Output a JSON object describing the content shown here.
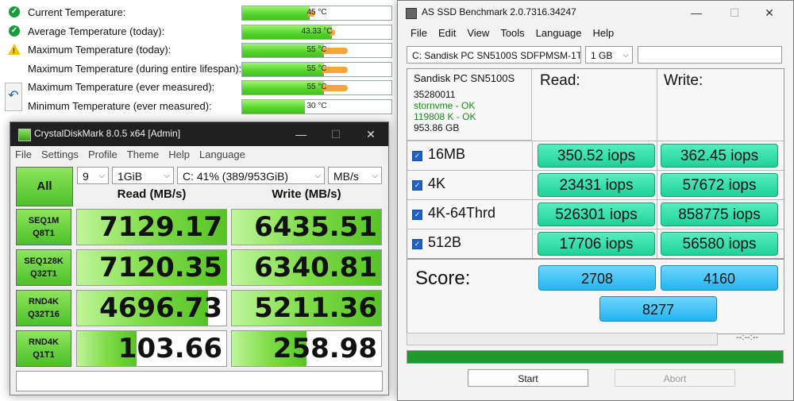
{
  "temps": [
    {
      "label": "Current Temperature:",
      "value": "45 °C",
      "status": "ok",
      "fill": 0.45,
      "orange": 0.05
    },
    {
      "label": "Average Temperature (today):",
      "value": "43.33 °C",
      "status": "ok",
      "fill": 0.6,
      "orange": 0.03
    },
    {
      "label": "Maximum Temperature (today):",
      "value": "55 °C",
      "status": "warn",
      "fill": 0.55,
      "orange": 0.17
    },
    {
      "label": "Maximum Temperature (during entire lifespan):",
      "value": "55 °C",
      "status": "none",
      "fill": 0.55,
      "orange": 0.17
    },
    {
      "label": "Maximum Temperature (ever measured):",
      "value": "55 °C",
      "status": "none",
      "fill": 0.55,
      "orange": 0.17
    },
    {
      "label": "Minimum Temperature (ever measured):",
      "value": "30 °C",
      "status": "none",
      "fill": 0.42,
      "orange": 0.0
    }
  ],
  "cdm": {
    "title": "CrystalDiskMark 8.0.5 x64 [Admin]",
    "menu": [
      "File",
      "Settings",
      "Profile",
      "Theme",
      "Help",
      "Language"
    ],
    "all_label": "All",
    "count": "9",
    "size": "1GiB",
    "drive": "C: 41% (389/953GiB)",
    "unit": "MB/s",
    "read_header": "Read (MB/s)",
    "write_header": "Write (MB/s)",
    "rows": [
      {
        "l1": "SEQ1M",
        "l2": "Q8T1",
        "read": "7129.17",
        "write": "6435.51",
        "read_fill": 1.0,
        "write_fill": 1.0
      },
      {
        "l1": "SEQ128K",
        "l2": "Q32T1",
        "read": "7120.35",
        "write": "6340.81",
        "read_fill": 1.0,
        "write_fill": 1.0
      },
      {
        "l1": "RND4K",
        "l2": "Q32T16",
        "read": "4696.73",
        "write": "5211.36",
        "read_fill": 0.88,
        "write_fill": 1.0
      },
      {
        "l1": "RND4K",
        "l2": "Q1T1",
        "read": "103.66",
        "write": "258.98",
        "read_fill": 0.4,
        "write_fill": 0.5
      }
    ]
  },
  "asd": {
    "title": "AS SSD Benchmark 2.0.7316.34247",
    "menu": [
      "File",
      "Edit",
      "View",
      "Tools",
      "Language",
      "Help"
    ],
    "drive_select": "C: Sandisk PC SN5100S SDFPMSM-1T00",
    "size_select": "1 GB",
    "info": {
      "model": "Sandisk PC SN5100S",
      "fw": "35280011",
      "driver": "stornvme - OK",
      "align": "119808 K - OK",
      "capacity": "953.86 GB"
    },
    "read_header": "Read:",
    "write_header": "Write:",
    "tests": [
      {
        "name": "16MB",
        "read": "350.52 iops",
        "write": "362.45 iops"
      },
      {
        "name": "4K",
        "read": "23431 iops",
        "write": "57672 iops"
      },
      {
        "name": "4K-64Thrd",
        "read": "526301 iops",
        "write": "858775 iops"
      },
      {
        "name": "512B",
        "read": "17706 iops",
        "write": "56580 iops"
      }
    ],
    "score_label": "Score:",
    "score_read": "2708",
    "score_write": "4160",
    "score_total": "8277",
    "time": "--:--:--",
    "progress": 1.0,
    "start_label": "Start",
    "abort_label": "Abort",
    "colors": {
      "metric": "#2ee0a8",
      "score": "#33bdf2",
      "progress": "#1e9a2c"
    }
  }
}
